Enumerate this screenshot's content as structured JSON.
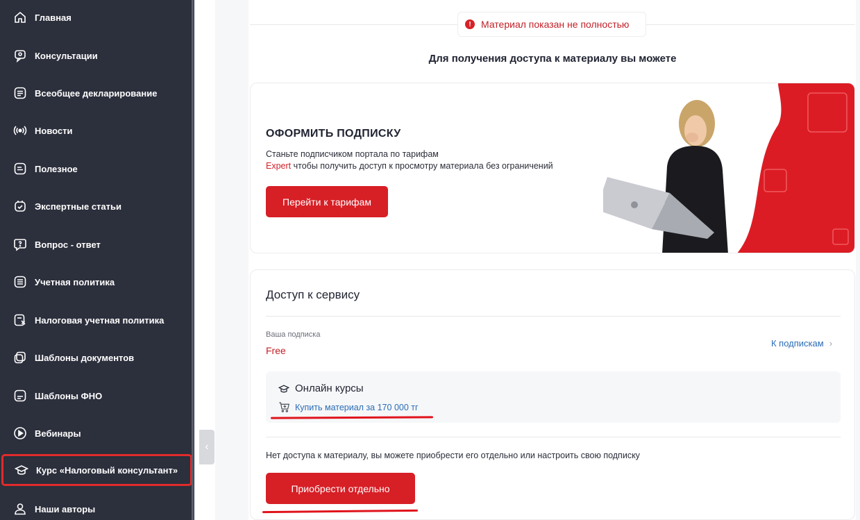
{
  "sidebar": {
    "items": [
      {
        "label": "Главная",
        "icon": "home-icon"
      },
      {
        "label": "Консультации",
        "icon": "consult-icon"
      },
      {
        "label": "Всеобщее декларирование",
        "icon": "document-list-icon"
      },
      {
        "label": "Новости",
        "icon": "broadcast-icon"
      },
      {
        "label": "Полезное",
        "icon": "useful-icon"
      },
      {
        "label": "Экспертные статьи",
        "icon": "expert-icon"
      },
      {
        "label": "Вопрос - ответ",
        "icon": "question-icon"
      },
      {
        "label": "Учетная политика",
        "icon": "policy-icon"
      },
      {
        "label": "Налоговая учетная политика",
        "icon": "tax-policy-icon"
      },
      {
        "label": "Шаблоны документов",
        "icon": "templates-icon"
      },
      {
        "label": "Шаблоны ФНО",
        "icon": "fno-templates-icon"
      },
      {
        "label": "Вебинары",
        "icon": "play-icon"
      },
      {
        "label": "Курс «Налоговый консультант»",
        "icon": "graduation-cap-icon",
        "active": true
      },
      {
        "label": "Наши авторы",
        "icon": "authors-icon"
      }
    ]
  },
  "notice": {
    "text": "Материал показан не полностью",
    "icon": "exclamation-icon"
  },
  "access": {
    "heading": "Для получения доступа к материалу вы можете"
  },
  "subscribe": {
    "title": "ОФОРМИТЬ ПОДПИСКУ",
    "text_line1": "Станьте подписчиком портала по тарифам",
    "text_expert": "Expert",
    "text_line2": " чтобы получить доступ к просмотру материала без ограничений",
    "button": "Перейти к тарифам"
  },
  "service": {
    "title": "Доступ к сервису",
    "subscription_label": "Ваша подписка",
    "subscription_value": "Free",
    "subscriptions_link": "К подпискам",
    "course_title": "Онлайн курсы",
    "buy_link": "Купить материал за 170 000 тг",
    "note": "Нет доступа к материалу, вы можете приобрести его отдельно или настроить свою подписку",
    "buy_button": "Приобрести отдельно"
  },
  "colors": {
    "accent": "#d71f26",
    "link": "#2a6cb6",
    "sidebar": "#2c2f3c"
  }
}
